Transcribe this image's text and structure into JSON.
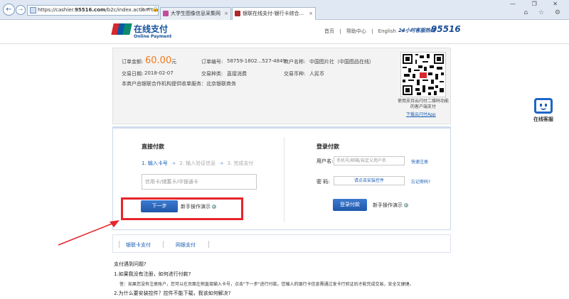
{
  "browser": {
    "url_prefix": "https://cashier.",
    "url_host": "95516.com",
    "url_path": "/b2c/index.action?trar",
    "addr_tools": "ρ ▾ 🔒 ↻ ×",
    "tabs": [
      {
        "label": "大学生图像信息采集网"
      },
      {
        "label": "银联在线支付-银行卡综合..."
      }
    ],
    "window_controls": "— ❐ ✕",
    "right_tools": "⌂ ☆ ⚙"
  },
  "header": {
    "logo_title": "在线支付",
    "logo_sub": "Online Payment",
    "nav": [
      "首页",
      "|",
      "帮助中心",
      "|",
      "English",
      "▾"
    ],
    "hotline_label": "24小时客服热线",
    "hotline_number": "95516"
  },
  "order": {
    "amount_label": "订单金额:",
    "amount_value": "60.00",
    "amount_unit": "元",
    "order_no_label": "订单编号:",
    "order_no": "58759-1802...527-4849",
    "merchant_label": "商户名称:",
    "merchant": "中国图片社（中国图品在线）",
    "date_label": "交易日期:",
    "date": "2018-02-07",
    "type_label": "交易种类:",
    "type": "直接消费",
    "currency_label": "交易币种:",
    "currency": "人民币",
    "provider_note": "本商户由银联合作机构提供收单服务：北京银联商务",
    "qr_caption": "使用支持云闪付二维码功能的客户端支付",
    "qr_link": "下载云闪付App"
  },
  "support": {
    "label": "在线客服"
  },
  "direct_pay": {
    "title": "直接付款",
    "steps": [
      "1. 输入卡号",
      "2. 输入验证信息",
      "3. 完成支付"
    ],
    "card_placeholder": "信用卡/储蓄卡/中银通卡",
    "next_button": "下一步",
    "demo_link": "新手操作演示"
  },
  "login_pay": {
    "title": "登录付款",
    "username_label": "用户名:",
    "username_placeholder": "手机号/邮箱/自定义用户名",
    "register_link": "快速注册",
    "password_label": "密   码:",
    "password_control": "请点击安装控件",
    "forgot_link": "忘记密码?",
    "login_button": "登录付款",
    "demo_link": "新手操作演示"
  },
  "pay_tabs": [
    "银联卡支付",
    "网银支付"
  ],
  "faq": {
    "title": "支付遇到问题?",
    "q1": "1.如果我没有注册，如何进行付款?",
    "a1": "答：如果您没有注册账户，您可以在页面左侧直接输入卡号，点击\"下一步\"进行付款。您输入的银行卡信息需通过发卡行验证后才能完成交易，安全又便捷。",
    "q2": "2.为什么要安装控件？控件不能下载，我该如何解决?"
  },
  "colors": {
    "brand_blue": "#1a5fb4",
    "amount_orange": "#f07a1b",
    "annotation_red": "#e6242b"
  }
}
